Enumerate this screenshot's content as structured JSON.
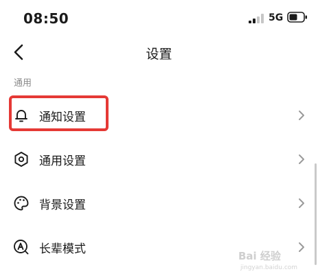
{
  "status_bar": {
    "time": "08:50",
    "network": "5G"
  },
  "nav": {
    "title": "设置"
  },
  "section": {
    "label": "通用"
  },
  "settings": [
    {
      "label": "通知设置",
      "icon": "bell-icon"
    },
    {
      "label": "通用设置",
      "icon": "gear-icon"
    },
    {
      "label": "背景设置",
      "icon": "palette-icon"
    },
    {
      "label": "长辈模式",
      "icon": "elder-mode-icon"
    }
  ],
  "watermark": {
    "text": "Bai 经验",
    "sub": "jingyan.baidu.com"
  },
  "colors": {
    "highlight": "#e53935",
    "text": "#1b1b1b",
    "secondary": "#8a8a8a"
  }
}
